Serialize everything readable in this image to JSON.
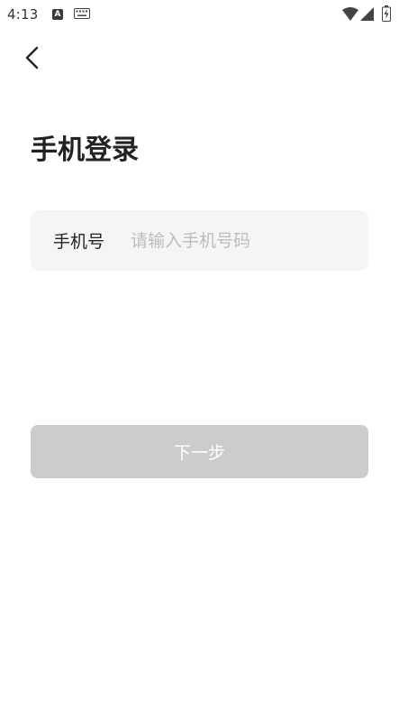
{
  "status_bar": {
    "time": "4:13",
    "icons": [
      "a-notification-icon",
      "keyboard-icon",
      "wifi-icon",
      "signal-icon",
      "battery-charging-icon"
    ]
  },
  "nav": {
    "back_icon": "chevron-left-icon"
  },
  "page": {
    "title": "手机登录"
  },
  "phone_field": {
    "label": "手机号",
    "value": "",
    "placeholder": "请输入手机号码"
  },
  "next_button": {
    "label": "下一步",
    "enabled": false
  },
  "colors": {
    "background": "#ffffff",
    "input_background": "#f5f5f5",
    "button_disabled_background": "#cccccc",
    "button_text": "#ffffff",
    "placeholder": "#bdbdbd",
    "text": "#222222"
  }
}
